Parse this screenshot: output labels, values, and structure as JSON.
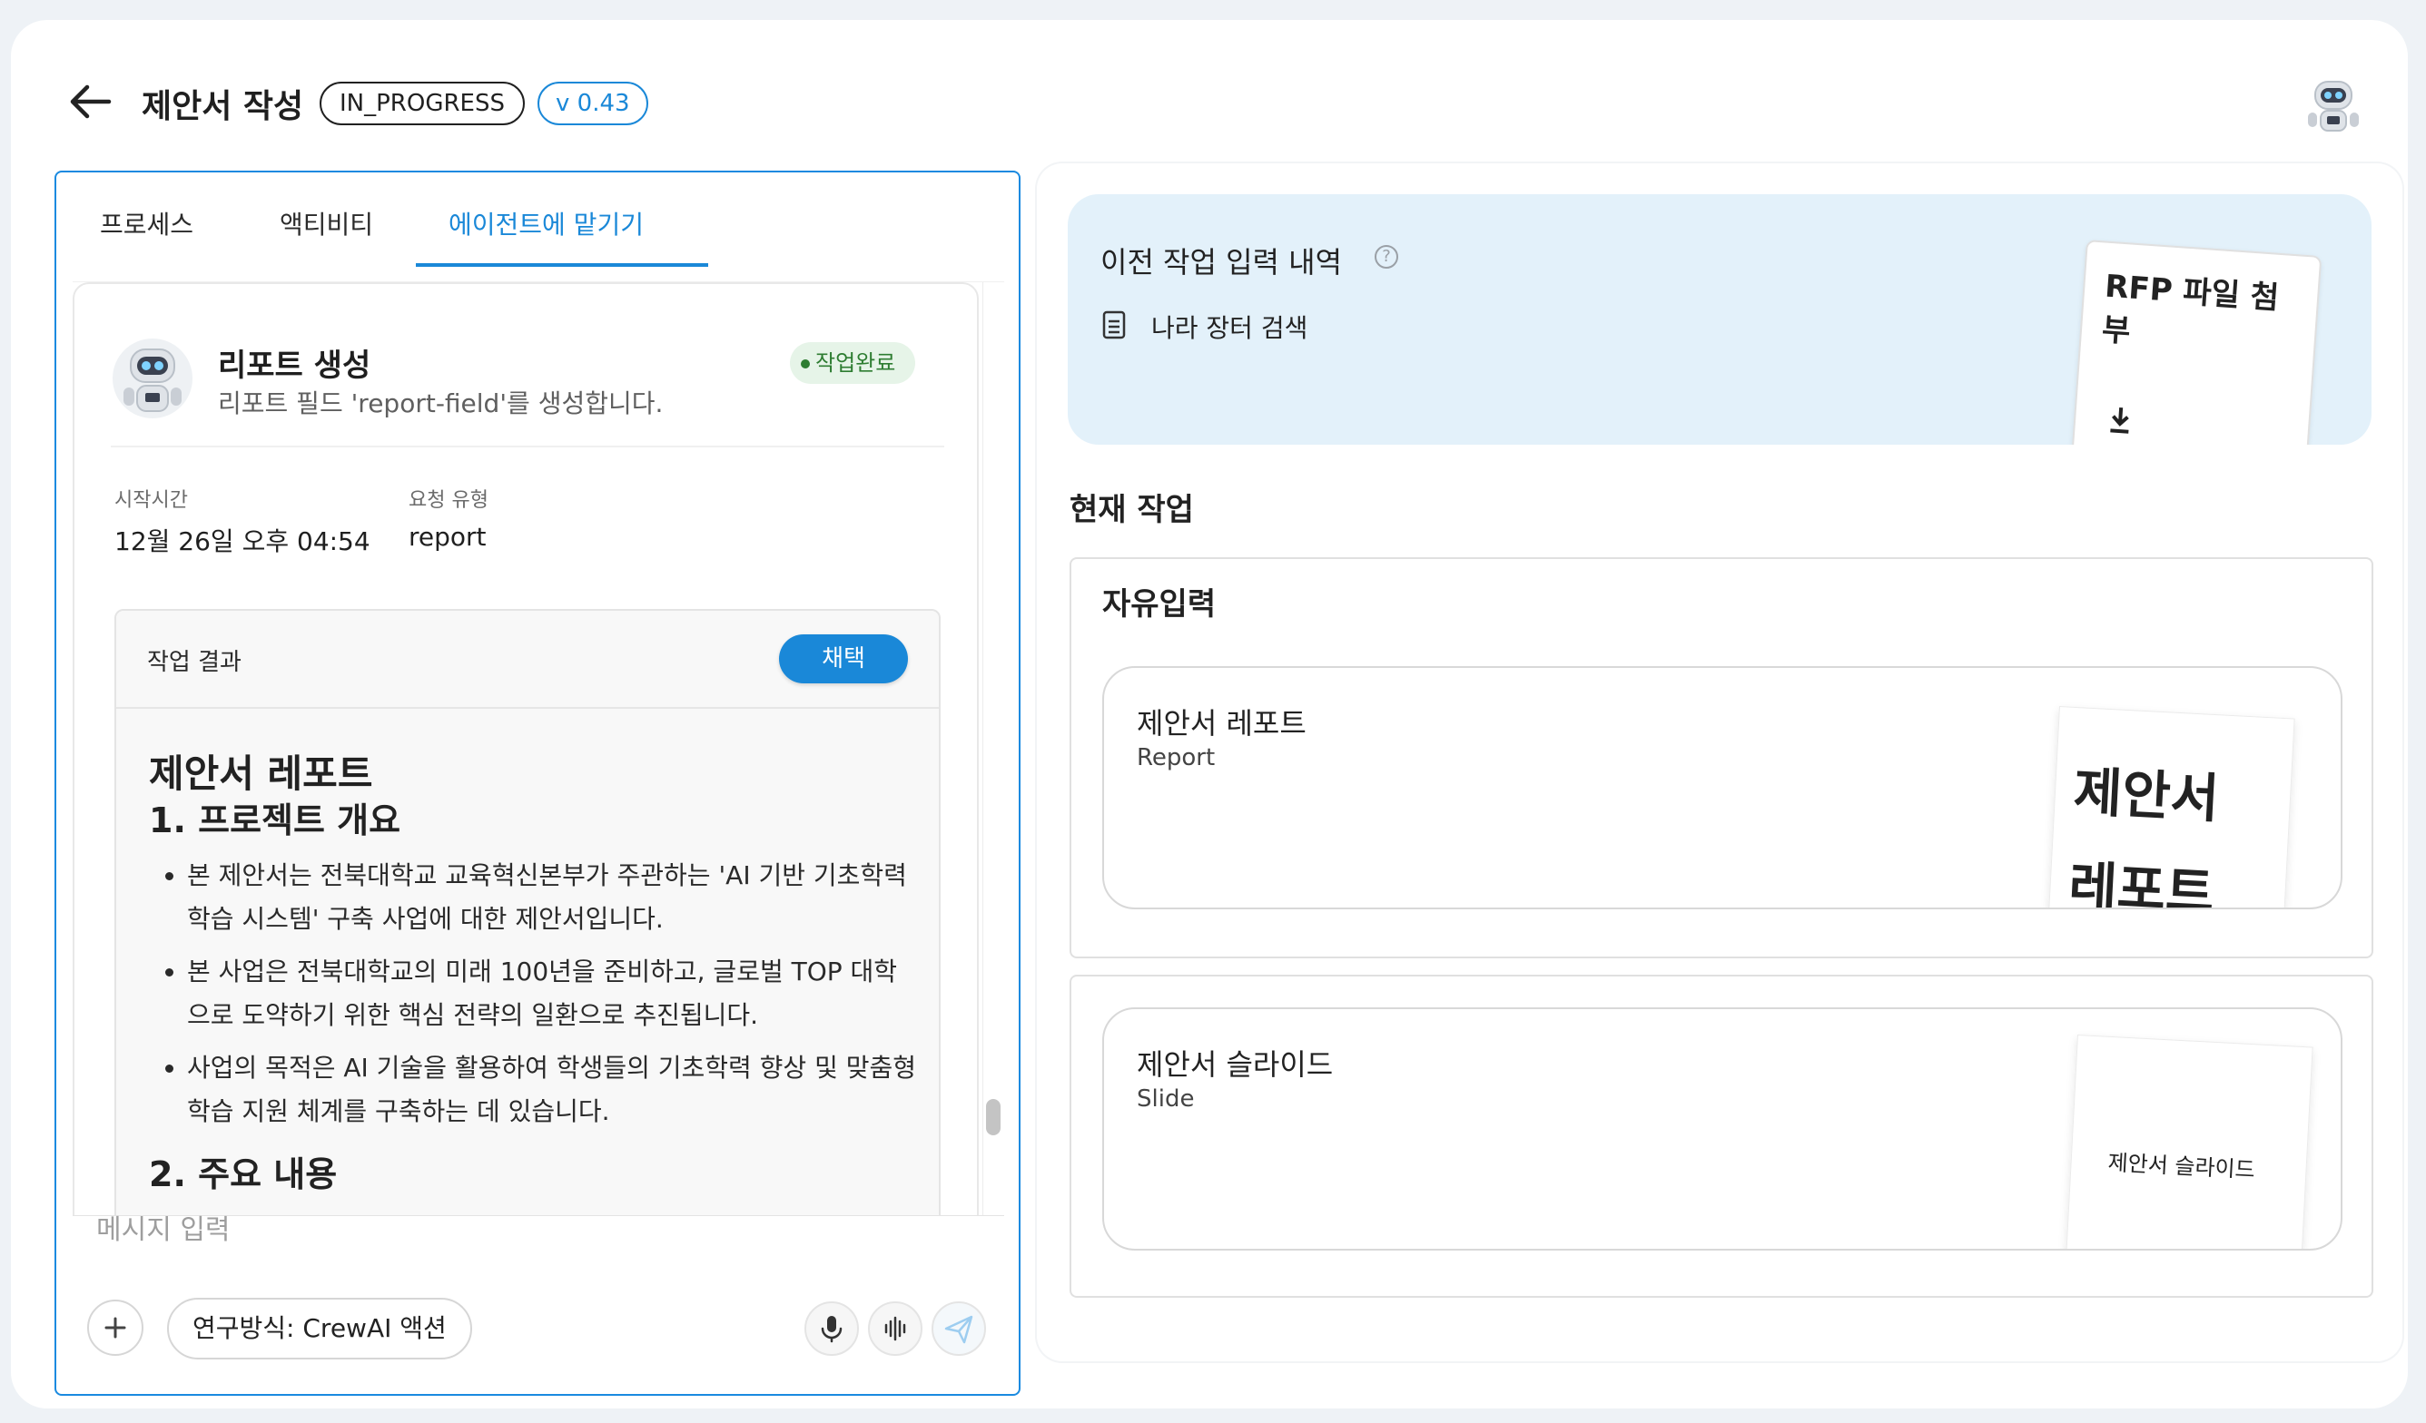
{
  "header": {
    "title": "제안서 작성",
    "status": "IN_PROGRESS",
    "version": "v 0.43"
  },
  "left_panel": {
    "tabs": [
      {
        "label": "프로세스"
      },
      {
        "label": "액티비티"
      },
      {
        "label": "에이전트에 맡기기"
      }
    ],
    "task_card": {
      "title": "리포트 생성",
      "description": "리포트 필드 'report-field'를 생성합니다.",
      "status_badge": "작업완료",
      "meta": {
        "start_time_label": "시작시간",
        "start_time_value": "12월 26일 오후 04:54",
        "request_type_label": "요청 유형",
        "request_type_value": "report"
      },
      "result": {
        "label": "작업 결과",
        "adopt_button": "채택",
        "doc_title": "제안서 레포트",
        "section1_title": "1. 프로젝트 개요",
        "bullets": [
          "본 제안서는 전북대학교 교육혁신본부가 주관하는 'AI 기반 기초학력 학습 시스템' 구축 사업에 대한 제안서입니다.",
          "본 사업은 전북대학교의 미래 100년을 준비하고, 글로벌 TOP 대학으로 도약하기 위한 핵심 전략의 일환으로 추진됩니다.",
          "사업의 목적은 AI 기술을 활용하여 학생들의 기초학력 향상 및 맞춤형 학습 지원 체계를 구축하는 데 있습니다."
        ],
        "section2_title": "2. 주요 내용"
      }
    },
    "composer": {
      "placeholder": "메시지 입력",
      "mode_chip": "연구방식: CrewAI 액션"
    }
  },
  "right_panel": {
    "previous": {
      "title": "이전 작업 입력 내역",
      "items": [
        {
          "label": "나라 장터 검색"
        }
      ],
      "attachment": {
        "label": "RFP 파일 첨부"
      }
    },
    "current_title": "현재 작업",
    "groups": [
      {
        "title": "자유입력",
        "item": {
          "title": "제안서 레포트",
          "subtitle": "Report",
          "preview": "제안서 레포트"
        }
      },
      {
        "title": "",
        "item": {
          "title": "제안서 슬라이드",
          "subtitle": "Slide",
          "preview": "제안서 슬라이드"
        }
      }
    ]
  },
  "colors": {
    "accent": "#1a88d8",
    "success": "#2e7d32",
    "success_bg": "#e6f4e8",
    "info_bg": "#e3f1fa"
  }
}
